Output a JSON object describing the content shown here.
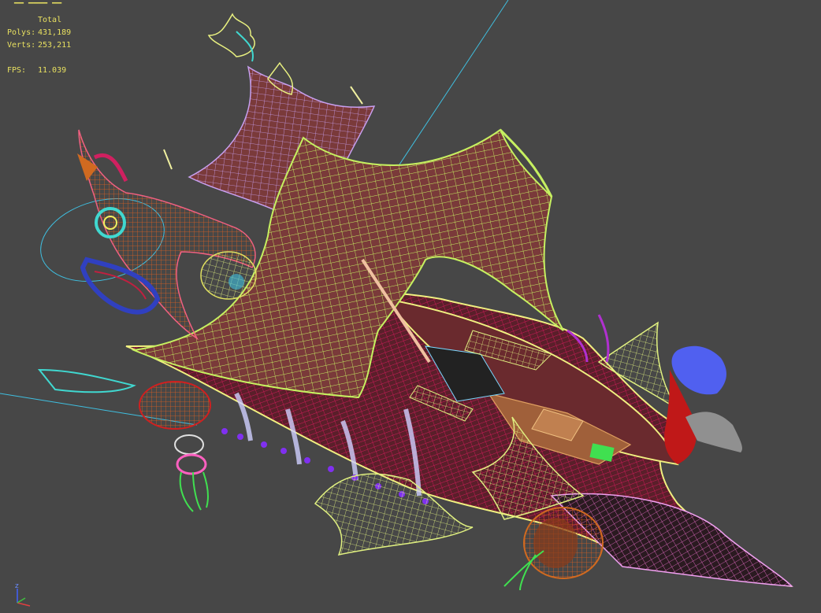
{
  "viewport": {
    "background": "#474747",
    "stats": {
      "total_label": "Total",
      "polys_label": "Polys:",
      "polys_value": "431,189",
      "verts_label": "Verts:",
      "verts_value": "253,211",
      "fps_label": "FPS:",
      "fps_value": "11.039",
      "text_color": "#e8e060"
    },
    "gizmo": {
      "z_label": "z",
      "x_color": "#e04040",
      "y_color": "#40c040",
      "z_color": "#4060ff"
    },
    "model": {
      "name_icon": "wireframe-airship-icon",
      "colors": {
        "sail": "#c6f060",
        "sail_fill": "#7a3a3a",
        "sail_back": "#c8a0f0",
        "hull": "#d01a5a",
        "hull_fill": "#5a1f2a",
        "deck": "#b07050",
        "cyan": "#40d8d0",
        "blue": "#3040c0",
        "pink": "#ff60c0",
        "red": "#c02020",
        "orange": "#d06a20",
        "green": "#40e050",
        "figurehead": "#5060f0"
      }
    }
  }
}
